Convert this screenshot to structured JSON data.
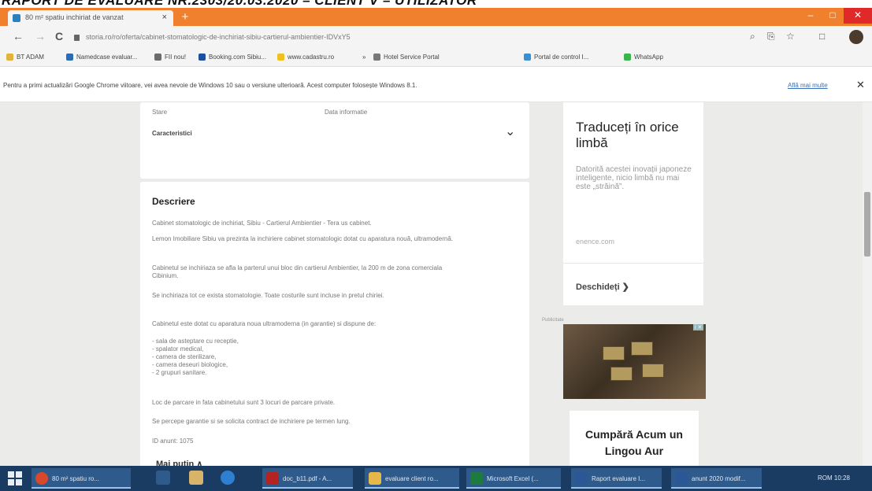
{
  "document_header": "RAPORT DE EVALUARE NR.2303/20.03.2020 – CLIENT V – UTILIZATOR",
  "browser": {
    "tab_title": "80 m² spatiu inchiriat de vanzat",
    "tab_close": "×",
    "new_tab": "+",
    "window_controls": [
      "–",
      "□",
      "✕"
    ],
    "nav": {
      "back": "←",
      "forward": "→",
      "reload": "C"
    },
    "url": "storia.ro/ro/oferta/cabinet-stomatologic-de-inchiriat-sibiu-cartierul-ambientier-IDVxY5",
    "toolbar_icons": [
      "⌕",
      "⎘",
      "☆",
      "□"
    ],
    "bookmarks": [
      {
        "label": "BT ADAM",
        "color": "#e3b23c"
      },
      {
        "label": "Namedcase evaluar...",
        "color": "#2c6cb0"
      },
      {
        "label": "FII nou!",
        "color": "#6b6b6b"
      },
      {
        "label": "Booking.com Sibiu...",
        "color": "#1d4fa0"
      },
      {
        "label": "www.cadastru.ro",
        "color": "#f0c020"
      },
      {
        "label": "Hotel Service Portal",
        "color": "#777777"
      },
      {
        "label": "Portal de control I...",
        "color": "#3b8fd0"
      },
      {
        "label": "WhatsApp",
        "color": "#3ab54a"
      }
    ],
    "bookmarks_more": "»",
    "infobar_message": "Pentru a primi actualizări Google Chrome viitoare, vei avea nevoie de Windows 10 sau o versiune ulterioară. Acest computer folosește Windows 8.1.",
    "infobar_link": "Află mai multe",
    "infobar_close": "✕"
  },
  "listing": {
    "stare_label": "Stare",
    "stare_value": "Data informatie",
    "characteristics_label": "Caracteristici",
    "characteristics_chevron": "⌄",
    "description_heading": "Descriere",
    "description_paragraphs": [
      "Cabinet stomatologic de inchiriat, Sibiu - Cartierul Ambientier - Tera us cabinet.",
      "Lemon Imobiliare Sibiu va prezinta la inchiriere cabinet stomatologic dotat cu aparatura nouă, ultramodernă.",
      "Cabinetul se inchiriaza se afla la parterul unui bloc din cartierul Ambientier, la 200 m de zona comerciala Cibinium.",
      "Se inchiriaza tot ce exista stomatologie. Toate costurile sunt incluse in pretul chiriei.",
      "Cabinetul este dotat cu aparatura noua ultramoderna (in garantie) si dispune de:",
      "- sala de asteptare cu receptie,\n- spalator medical,\n- camera de sterilizare,\n- camera deseuri biologice,\n- 2 grupuri sanitare.",
      "Loc de parcare in fata cabinetului sunt 3 locuri de parcare private.",
      "Se percepe garantie si se solicita contract de inchiriere pe termen lung.",
      "ID anunt: 1075"
    ],
    "show_more": "Mai puțin ∧"
  },
  "ads": {
    "translate_title": "Traduceți în orice limbă",
    "translate_body": "Datorită acestei inovații japoneze inteligente, nicio limbă nu mai este „străină”.",
    "translate_site": "enence.com",
    "open_label": "Deschideți ❯",
    "ad_tag": "Publicitate",
    "ad_marker": "i ✕",
    "gold_title": "Cumpără Acum un Lingou Aur"
  },
  "taskbar": {
    "items": [
      {
        "label": "80 m² spatiu ro...",
        "color": "#d9482b"
      },
      {
        "label": "doc_b11.pdf - A...",
        "color": "#b52222"
      },
      {
        "label": "evaluare client ro...",
        "color": "#e6b84a"
      },
      {
        "label": "Microsoft Excel (...",
        "color": "#1f7a3f"
      },
      {
        "label": "Raport evaluare I...",
        "color": "#2b5797"
      },
      {
        "label": "anunt 2020 modif...",
        "color": "#2b5797"
      }
    ],
    "tray": "ROM 10:28"
  }
}
